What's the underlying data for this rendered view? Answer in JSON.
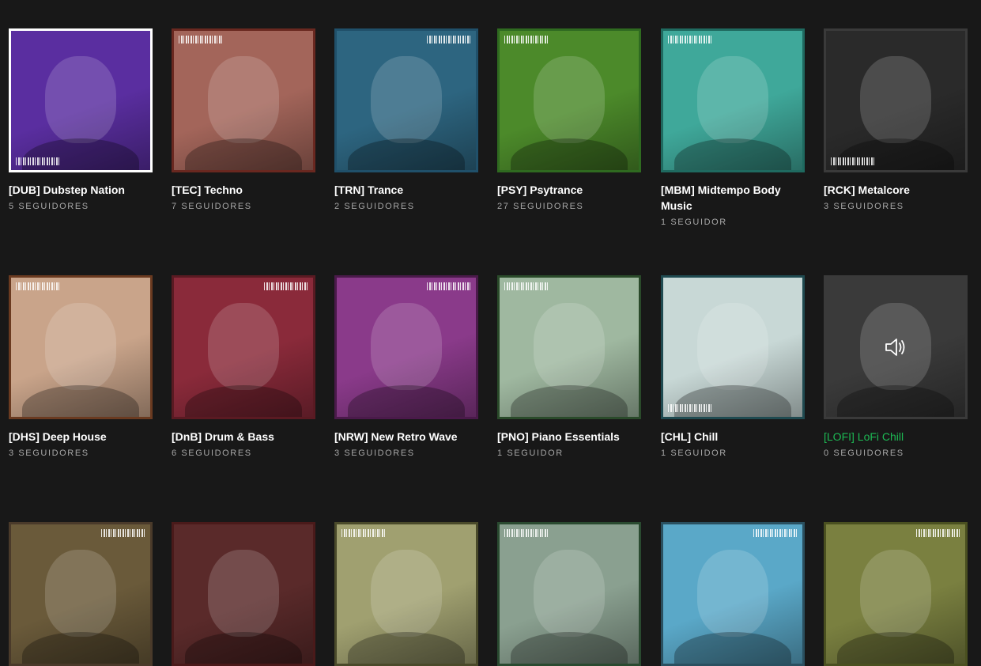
{
  "rows": [
    {
      "cards": [
        {
          "title": "[DUB] Dubstep Nation",
          "followers": "5 SEGUIDORES",
          "color": "#5a2ea0",
          "border": "#ffffff",
          "barcode": "bl",
          "active": false
        },
        {
          "title": "[TEC] Techno",
          "followers": "7 SEGUIDORES",
          "color": "#a3655a",
          "border": "#6a2820",
          "barcode": "tl",
          "active": false
        },
        {
          "title": "[TRN] Trance",
          "followers": "2 SEGUIDORES",
          "color": "#2d6580",
          "border": "#20506a",
          "barcode": "tr",
          "active": false
        },
        {
          "title": "[PSY] Psytrance",
          "followers": "27 SEGUIDORES",
          "color": "#4c8a2a",
          "border": "#2f6a20",
          "barcode": "tl",
          "active": false
        },
        {
          "title": "[MBM] Midtempo Body Music",
          "followers": "1 SEGUIDOR",
          "color": "#3fa89a",
          "border": "#1f6a60",
          "barcode": "tl",
          "active": false
        },
        {
          "title": "[RCK] Metalcore",
          "followers": "3 SEGUIDORES",
          "color": "#2a2a2a",
          "border": "#3a3a3a",
          "barcode": "bl",
          "active": false
        }
      ]
    },
    {
      "cards": [
        {
          "title": "[DHS] Deep House",
          "followers": "3 SEGUIDORES",
          "color": "#c9a48a",
          "border": "#6a3a20",
          "barcode": "tl",
          "active": false
        },
        {
          "title": "[DnB] Drum & Bass",
          "followers": "6 SEGUIDORES",
          "color": "#8a2a3a",
          "border": "#5a1a22",
          "barcode": "tr",
          "active": false
        },
        {
          "title": "[NRW] New Retro Wave",
          "followers": "3 SEGUIDORES",
          "color": "#8a3a8a",
          "border": "#4a1a4a",
          "barcode": "tr",
          "active": false
        },
        {
          "title": "[PNO] Piano Essentials",
          "followers": "1 SEGUIDOR",
          "color": "#9fb8a0",
          "border": "#2a4a2a",
          "barcode": "tl",
          "active": false
        },
        {
          "title": "[CHL] Chill",
          "followers": "1 SEGUIDOR",
          "color": "#c8d8d6",
          "border": "#1f4a50",
          "barcode": "bl",
          "active": false
        },
        {
          "title": "[LOFI] LoFi Chill",
          "followers": "0 SEGUIDORES",
          "color": "#3a3a3a",
          "border": "#3a3a3a",
          "barcode": "none",
          "active": true
        }
      ]
    },
    {
      "cards": [
        {
          "title": "",
          "followers": "",
          "color": "#6a5a3a",
          "border": "#4a3a2a",
          "barcode": "tr",
          "active": false
        },
        {
          "title": "",
          "followers": "",
          "color": "#5a2a2a",
          "border": "#4a1a1a",
          "barcode": "none",
          "active": false
        },
        {
          "title": "",
          "followers": "",
          "color": "#a0a070",
          "border": "#4a4a2a",
          "barcode": "tl",
          "active": false
        },
        {
          "title": "",
          "followers": "",
          "color": "#8aa090",
          "border": "#2a4a30",
          "barcode": "tl",
          "active": false
        },
        {
          "title": "",
          "followers": "",
          "color": "#5aa8c8",
          "border": "#2a5060",
          "barcode": "tr",
          "active": false
        },
        {
          "title": "",
          "followers": "",
          "color": "#7a8040",
          "border": "#4a5020",
          "barcode": "tr",
          "active": false
        }
      ]
    }
  ]
}
